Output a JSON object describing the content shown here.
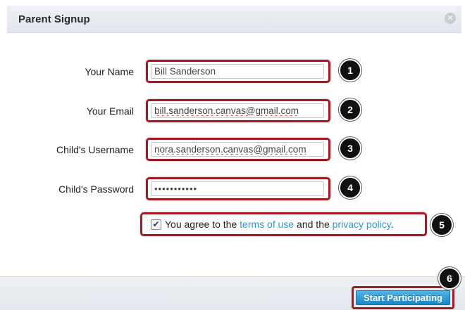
{
  "dialog": {
    "title": "Parent Signup",
    "close_icon": "close-icon"
  },
  "form": {
    "name_label": "Your Name",
    "name_value": "Bill Sanderson",
    "email_label": "Your Email",
    "email_value": "bill.sanderson.canvas@gmail.com",
    "username_label": "Child's Username",
    "username_value": "nora.sanderson.canvas@gmail.com",
    "password_label": "Child's Password",
    "password_value": "•••••••••••"
  },
  "agreement": {
    "checked": true,
    "prefix": "You agree to the ",
    "terms_link": "terms of use",
    "middle": " and the ",
    "privacy_link": "privacy policy",
    "suffix": "."
  },
  "footer": {
    "submit_label": "Start Participating"
  },
  "callouts": [
    "1",
    "2",
    "3",
    "4",
    "5",
    "6"
  ],
  "colors": {
    "annotation_outline": "#a31a22",
    "link": "#2a9ad4",
    "button": "#1a86c8"
  }
}
